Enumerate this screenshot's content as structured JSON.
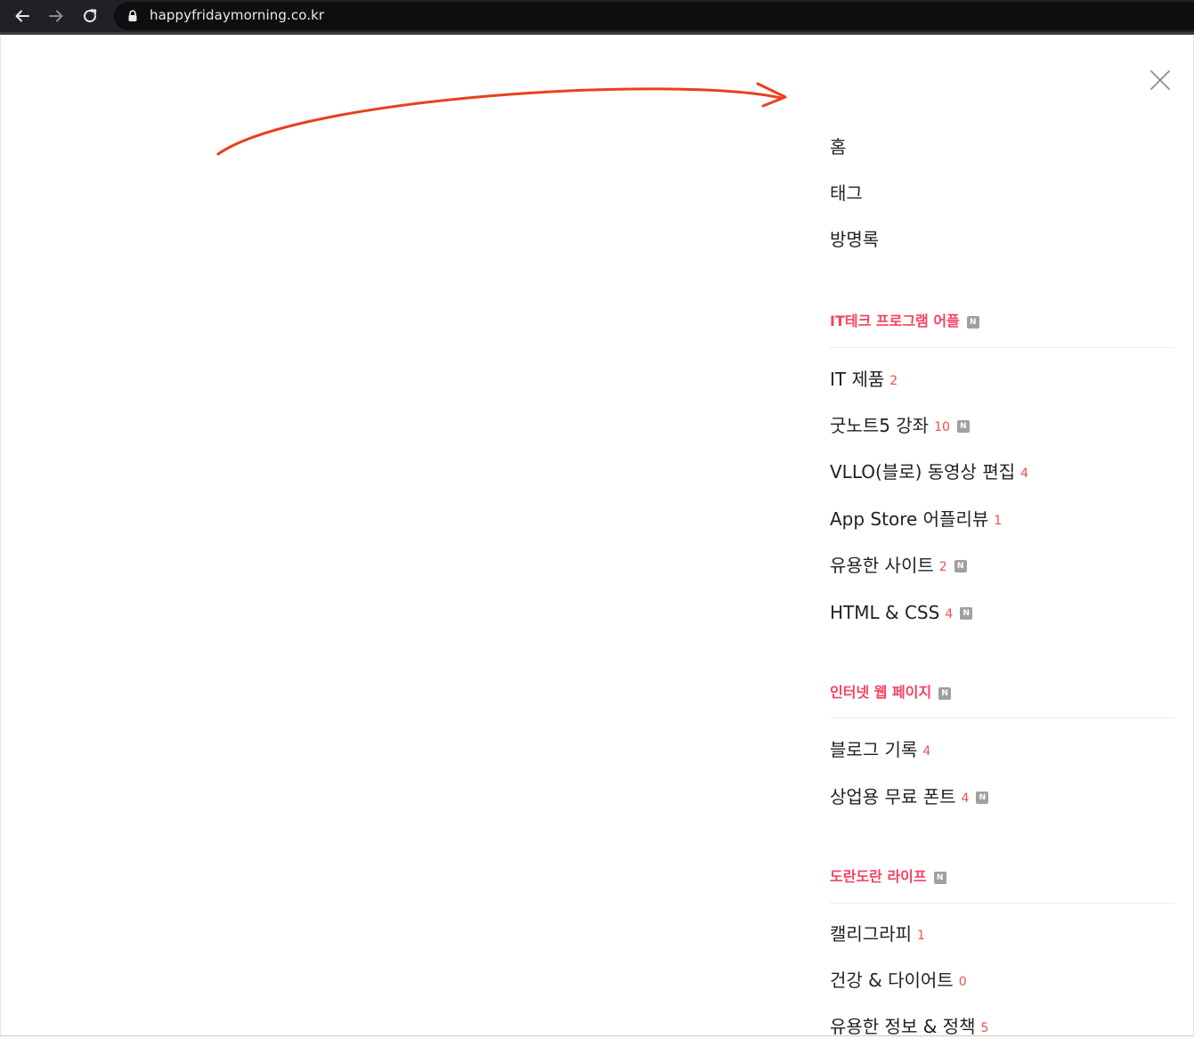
{
  "browser": {
    "url": "happyfridaymorning.co.kr",
    "icons": [
      "back-icon",
      "forward-icon",
      "reload-icon",
      "lock-icon"
    ]
  },
  "menu": {
    "top_items": [
      {
        "label": "홈"
      },
      {
        "label": "태그"
      },
      {
        "label": "방명록"
      }
    ],
    "sections": [
      {
        "title": "IT테크 프로그램 어플",
        "new": true,
        "categories": [
          {
            "label": "IT 제품",
            "count": "2",
            "new": false
          },
          {
            "label": "굿노트5 강좌",
            "count": "10",
            "new": true
          },
          {
            "label": "VLLO(블로) 동영상 편집",
            "count": "4",
            "new": false
          },
          {
            "label": "App Store 어플리뷰",
            "count": "1",
            "new": false
          },
          {
            "label": "유용한 사이트",
            "count": "2",
            "new": true
          },
          {
            "label": "HTML & CSS",
            "count": "4",
            "new": true
          }
        ]
      },
      {
        "title": "인터넷 웹 페이지",
        "new": true,
        "categories": [
          {
            "label": "블로그 기록",
            "count": "4",
            "new": false
          },
          {
            "label": "상업용 무료 폰트",
            "count": "4",
            "new": true
          }
        ]
      },
      {
        "title": "도란도란 라이프",
        "new": true,
        "categories": [
          {
            "label": "캘리그라피",
            "count": "1",
            "new": false
          },
          {
            "label": "건강 & 다이어트",
            "count": "0",
            "new": false
          },
          {
            "label": "유용한 정보 & 정책",
            "count": "5",
            "new": false
          }
        ]
      }
    ],
    "new_badge_text": "N"
  },
  "colors": {
    "section_title": "#f5435f",
    "count": "#f24e4e",
    "arrow": "#e8401c",
    "browser_bar": "#202124"
  }
}
